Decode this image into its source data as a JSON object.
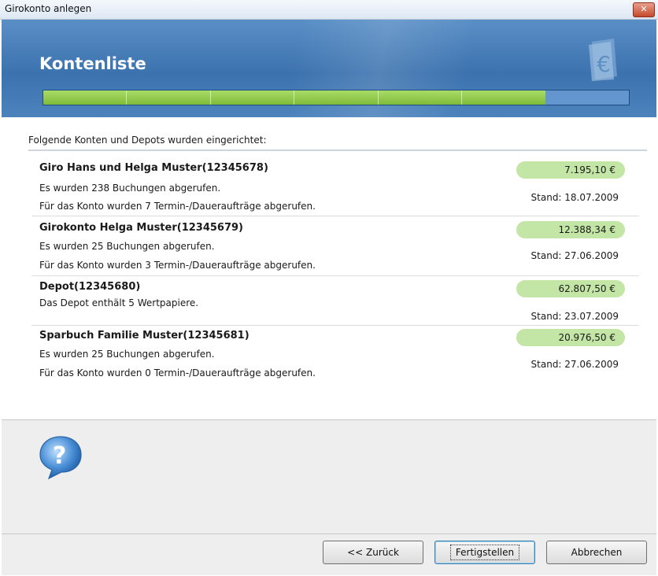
{
  "window": {
    "title": "Girokonto anlegen",
    "close_symbol": "✕"
  },
  "banner": {
    "title": "Kontenliste"
  },
  "progress": {
    "segments_done": 6,
    "segments_total": 7,
    "fraction": 0.86,
    "color_done": "#8cc84b",
    "color_rest": "#6396cf"
  },
  "intro": "Folgende Konten und Depots wurden eingerichtet:",
  "accounts": [
    {
      "name": "Giro Hans und Helga Muster(12345678)",
      "lines": [
        "Es wurden 238 Buchungen abgerufen.",
        "Für das Konto wurden 7 Termin-/Daueraufträge abgerufen."
      ],
      "amount": "7.195,10 €",
      "stand": "Stand: 18.07.2009"
    },
    {
      "name": "Girokonto Helga Muster(12345679)",
      "lines": [
        "Es wurden 25 Buchungen abgerufen.",
        "Für das Konto wurden 3 Termin-/Daueraufträge abgerufen."
      ],
      "amount": "12.388,34 €",
      "stand": "Stand: 27.06.2009"
    },
    {
      "name": "Depot(12345680)",
      "lines": [
        "Das Depot enthält 5 Wertpapiere."
      ],
      "amount": "62.807,50 €",
      "stand": "Stand: 23.07.2009"
    },
    {
      "name": "Sparbuch Familie Muster(12345681)",
      "lines": [
        "Es wurden 25 Buchungen abgerufen.",
        "Für das Konto wurden 0 Termin-/Daueraufträge abgerufen."
      ],
      "amount": "20.976,50 €",
      "stand": "Stand: 27.06.2009"
    }
  ],
  "buttons": {
    "back": "<< Zurück",
    "finish": "Fertigstellen",
    "cancel": "Abbrechen"
  },
  "icons": {
    "banner": "euro-document-icon",
    "help": "help-question-icon",
    "close": "close-icon"
  },
  "colors": {
    "banner": "#3c72ae",
    "amount_pill": "#c3e5a5",
    "panel": "#eeeeee"
  }
}
